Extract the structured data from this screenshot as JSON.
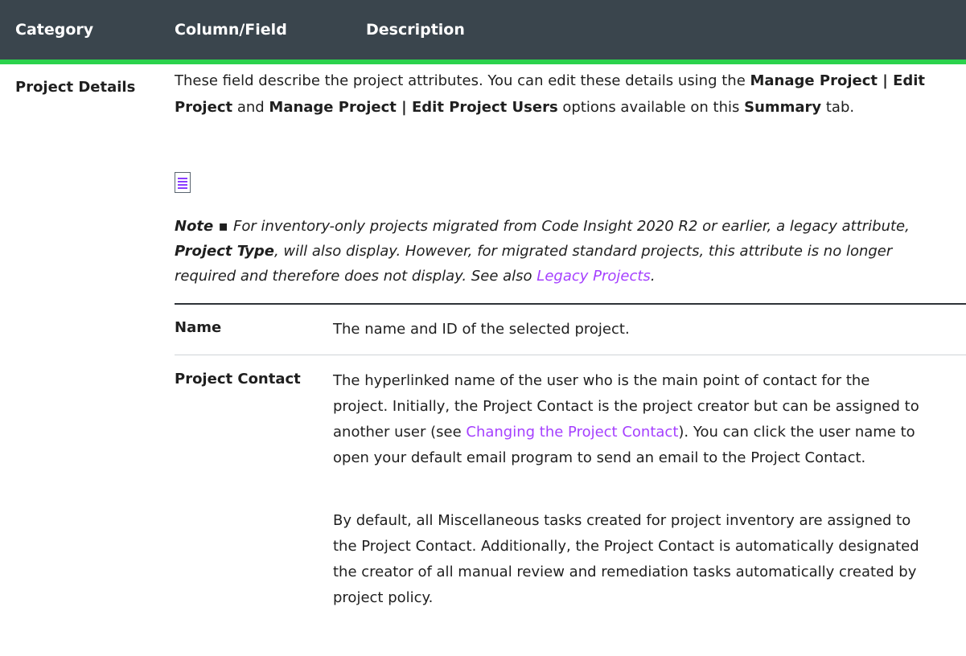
{
  "header": {
    "col_category": "Category",
    "col_field": "Column/Field",
    "col_description": "Description"
  },
  "row": {
    "category": "Project Details",
    "intro": {
      "t1": "These field describe the project attributes. You can edit these details using the ",
      "b1": "Manage Project | Edit Project",
      "t2": " and ",
      "b2": "Manage Project | Edit Project Users",
      "t3": " options available on this ",
      "b3": "Summary",
      "t4": " tab."
    },
    "note": {
      "label": "Note",
      "sep": " ▪ ",
      "t1": "For inventory-only projects migrated from Code Insight 2020 R2 or earlier, a legacy attribute, ",
      "b1": "Project Type",
      "t2": ", will also display. However, for migrated standard projects, this attribute is no longer required and therefore does not display. See also ",
      "link": "Legacy Projects",
      "t3": "."
    },
    "fields": [
      {
        "name": "Name",
        "desc": "The name and ID of the selected project."
      },
      {
        "name": "Project Contact",
        "desc_t1": "The hyperlinked name of the user who is the main point of contact for the project. Initially, the Project Contact is the project creator but can be assigned to another user (see ",
        "desc_link": "Changing the Project Contact",
        "desc_t2": "). You can click the user name to open your default email program to send an email to the Project Contact.",
        "desc2": "By default, all Miscellaneous tasks created for project inventory are assigned to the Project Contact. Additionally, the Project Contact is automatically designated the creator of all manual review and remediation tasks automatically created by project policy."
      }
    ]
  },
  "colors": {
    "header_bg": "#3a454d",
    "header_accent": "#2bd24c",
    "link": "#a540ff",
    "icon": "note-icon"
  }
}
